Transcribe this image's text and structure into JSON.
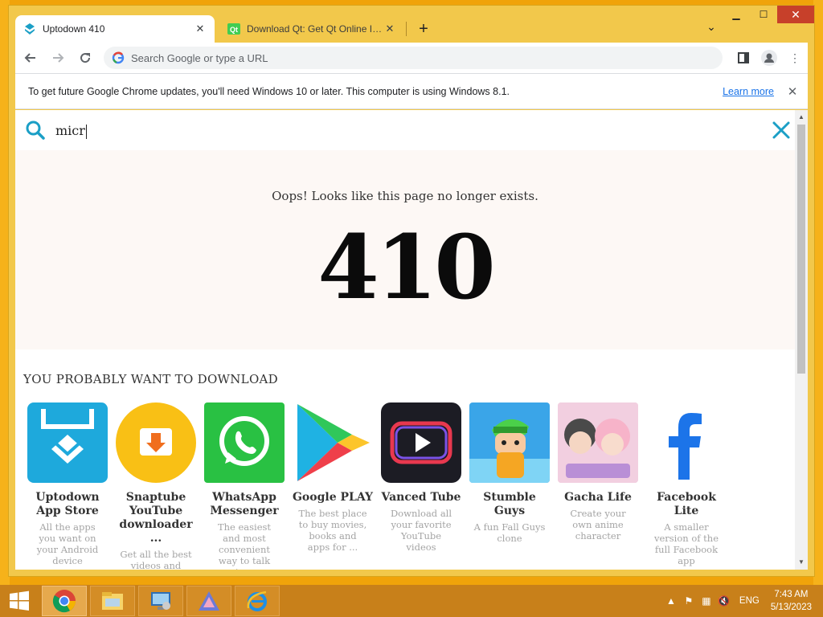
{
  "tabs": [
    {
      "title": "Uptodown 410",
      "active": true
    },
    {
      "title": "Download Qt: Get Qt Online Insta",
      "active": false
    }
  ],
  "new_tab_symbol": "+",
  "omnibox": {
    "placeholder": "Search Google or type a URL"
  },
  "infobar": {
    "message": "To get future Google Chrome updates, you'll need Windows 10 or later. This computer is using Windows 8.1.",
    "link": "Learn more"
  },
  "site_search": {
    "query": "micr"
  },
  "error": {
    "message": "Oops! Looks like this page no longer exists.",
    "code": "410"
  },
  "recommendations": {
    "title": "YOU PROBABLY WANT TO DOWNLOAD",
    "apps": [
      {
        "name": "Uptodown App Store",
        "desc": "All the apps you want on your Android device",
        "icon": "uptodown-icon"
      },
      {
        "name": "Snaptube YouTube downloader ...",
        "desc": "Get all the best videos and music",
        "icon": "snaptube-icon"
      },
      {
        "name": "WhatsApp Messenger",
        "desc": "The easiest and most convenient way to talk to...",
        "icon": "whatsapp-icon"
      },
      {
        "name": "Google PLAY",
        "desc": "The best place to buy movies, books and apps for ...",
        "icon": "google-play-icon"
      },
      {
        "name": "Vanced Tube",
        "desc": "Download all your favorite YouTube videos",
        "icon": "vanced-tube-icon"
      },
      {
        "name": "Stumble Guys",
        "desc": "A fun Fall Guys clone",
        "icon": "stumble-guys-icon"
      },
      {
        "name": "Gacha Life",
        "desc": "Create your own anime character",
        "icon": "gacha-life-icon"
      },
      {
        "name": "Facebook Lite",
        "desc": "A smaller version of the full Facebook app",
        "icon": "facebook-lite-icon"
      }
    ]
  },
  "taskbar": {
    "lang": "ENG",
    "time": "7:43 AM",
    "date": "5/13/2023"
  },
  "colors": {
    "accent": "#1b9fc6",
    "desktop": "#f0a30a"
  }
}
